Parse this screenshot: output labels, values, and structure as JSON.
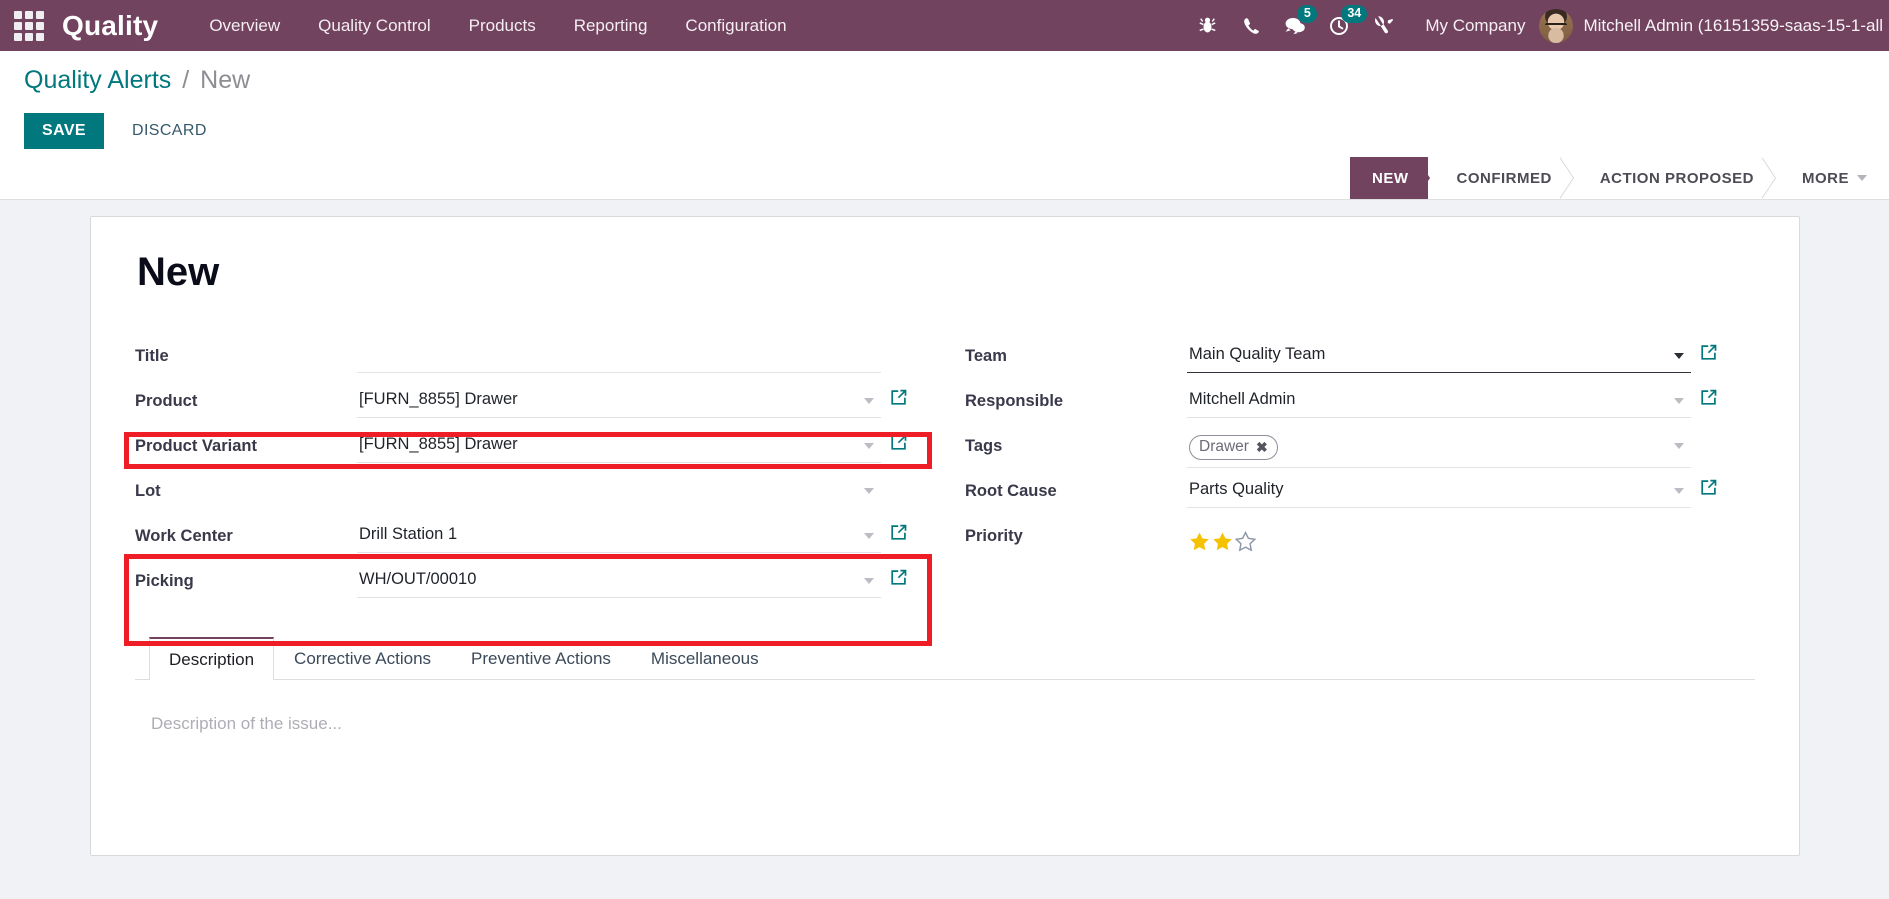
{
  "navbar": {
    "apps_icon": "apps-grid-icon",
    "brand": "Quality",
    "menu": [
      {
        "label": "Overview"
      },
      {
        "label": "Quality Control"
      },
      {
        "label": "Products"
      },
      {
        "label": "Reporting"
      },
      {
        "label": "Configuration"
      }
    ],
    "icons": [
      {
        "name": "bug-icon",
        "badge": ""
      },
      {
        "name": "phone-icon",
        "badge": ""
      },
      {
        "name": "messages-icon",
        "badge": "5"
      },
      {
        "name": "activities-clock-icon",
        "badge": "34"
      },
      {
        "name": "tools-icon",
        "badge": ""
      }
    ],
    "company": "My Company",
    "user_name": "Mitchell Admin (16151359-saas-15-1-all",
    "colors": {
      "header_bg": "#71435f",
      "badge_bg": "#00787d"
    }
  },
  "control_panel": {
    "breadcrumb_root": "Quality Alerts",
    "breadcrumb_sep": "/",
    "breadcrumb_current": "New",
    "save_label": "SAVE",
    "discard_label": "DISCARD",
    "statusbar": [
      {
        "label": "NEW",
        "active": true
      },
      {
        "label": "CONFIRMED",
        "active": false
      },
      {
        "label": "ACTION PROPOSED",
        "active": false
      },
      {
        "label": "MORE",
        "active": false
      }
    ]
  },
  "form": {
    "record_title": "New",
    "left_fields": [
      {
        "label": "Title",
        "value": "",
        "placeholder": "",
        "has_caret": false,
        "has_ext": false,
        "underline": "none"
      },
      {
        "label": "Product",
        "value": "[FURN_8855] Drawer",
        "placeholder": "",
        "has_caret": true,
        "has_ext": true,
        "underline": "light"
      },
      {
        "label": "Product Variant",
        "value": "[FURN_8855] Drawer",
        "placeholder": "",
        "has_caret": true,
        "has_ext": true,
        "underline": "light"
      },
      {
        "label": "Lot",
        "value": "",
        "placeholder": "",
        "has_caret": true,
        "has_ext": false,
        "underline": "none"
      },
      {
        "label": "Work Center",
        "value": "Drill Station 1",
        "placeholder": "",
        "has_caret": true,
        "has_ext": true,
        "underline": "light"
      },
      {
        "label": "Picking",
        "value": "WH/OUT/00010",
        "placeholder": "",
        "has_caret": true,
        "has_ext": true,
        "underline": "light"
      }
    ],
    "right_fields": [
      {
        "label": "Team",
        "value": "Main Quality Team",
        "has_caret": true,
        "has_ext": true,
        "underline": "strong",
        "type": "text"
      },
      {
        "label": "Responsible",
        "value": "Mitchell Admin",
        "has_caret": true,
        "has_ext": true,
        "underline": "light",
        "type": "text"
      },
      {
        "label": "Tags",
        "value": "Drawer",
        "has_caret": true,
        "has_ext": false,
        "underline": "light",
        "type": "tag"
      },
      {
        "label": "Root Cause",
        "value": "Parts Quality",
        "has_caret": true,
        "has_ext": true,
        "underline": "light",
        "type": "text"
      },
      {
        "label": "Priority",
        "value": "2",
        "has_caret": false,
        "has_ext": false,
        "underline": "none",
        "type": "stars"
      }
    ],
    "tag_remove_glyph": "✖",
    "priority": {
      "filled": 2,
      "total": 3,
      "filled_color": "#f4c200",
      "empty_color": "#8b97a8"
    },
    "highlights": [
      {
        "name": "product-field-highlight",
        "color": "#ef1d26"
      },
      {
        "name": "workcenter-picking-highlight",
        "color": "#ef1d26"
      }
    ]
  },
  "notebook": {
    "tabs": [
      {
        "label": "Description",
        "active": true
      },
      {
        "label": "Corrective Actions",
        "active": false
      },
      {
        "label": "Preventive Actions",
        "active": false
      },
      {
        "label": "Miscellaneous",
        "active": false
      }
    ],
    "description_placeholder": "Description of the issue..."
  }
}
